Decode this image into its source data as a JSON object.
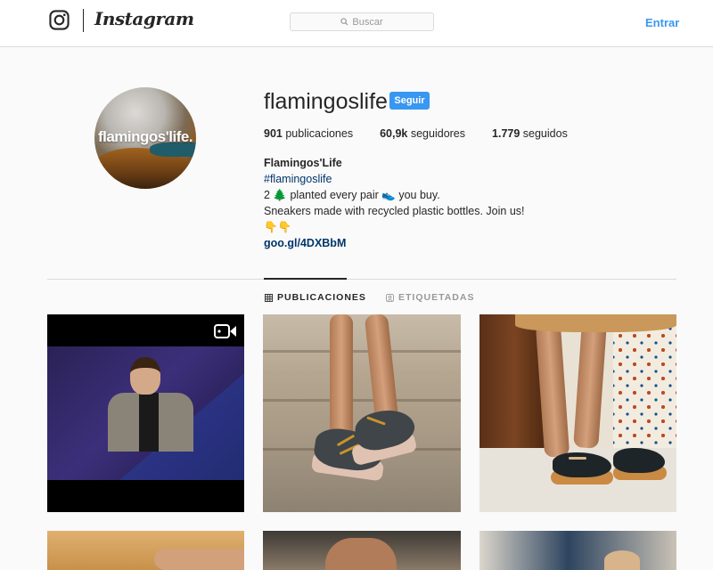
{
  "header": {
    "brand": "Instagram",
    "search_placeholder": "Buscar",
    "login_label": "Entrar"
  },
  "profile": {
    "username": "flamingoslife",
    "follow_label": "Seguir",
    "avatar_text": "flamingos'life.",
    "stats": {
      "posts_count": "901",
      "posts_label": "publicaciones",
      "followers_count": "60,9k",
      "followers_label": "seguidores",
      "following_count": "1.779",
      "following_label": "seguidos"
    },
    "bio": {
      "full_name": "Flamingos'Life",
      "hashtag": "#flamingoslife",
      "line1": "2 🌲 planted every pair 👟 you buy.",
      "line2": "Sneakers made with recycled plastic bottles. Join us!",
      "line3": "👇👇",
      "link": "goo.gl/4DXBbM"
    }
  },
  "tabs": [
    {
      "label": "PUBLICACIONES",
      "active": true,
      "icon": "grid-icon"
    },
    {
      "label": "ETIQUETADAS",
      "active": false,
      "icon": "tag-icon"
    }
  ],
  "colors": {
    "accent": "#3897f0",
    "link": "#003569",
    "text": "#262626",
    "border": "#dbdbdb"
  }
}
